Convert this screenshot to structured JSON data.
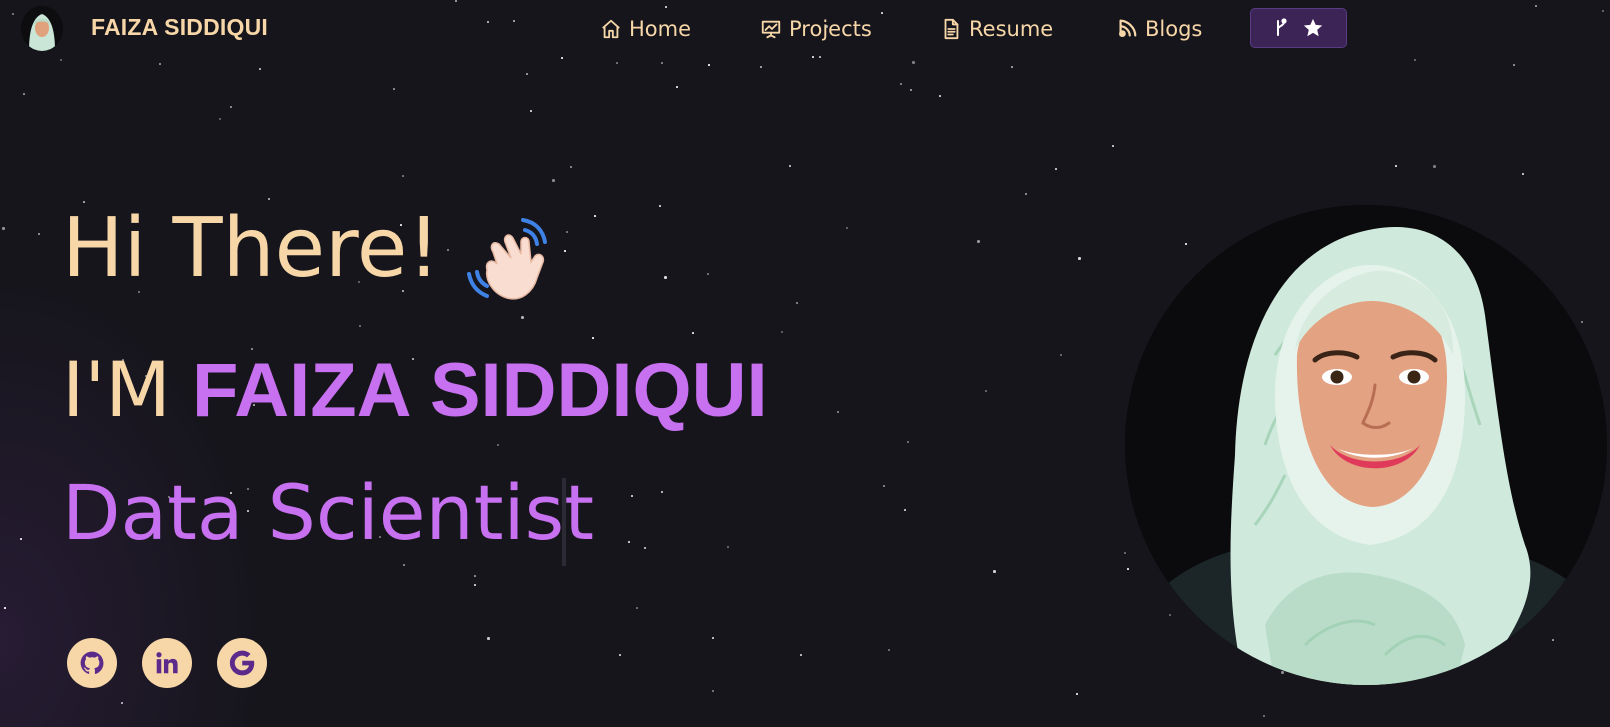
{
  "brand": {
    "name": "FAIZA SIDDIQUI",
    "avatar_icon": "avatar-photo"
  },
  "nav": {
    "items": [
      {
        "label": "Home",
        "icon": "home-icon"
      },
      {
        "label": "Projects",
        "icon": "presentation-chart-icon"
      },
      {
        "label": "Resume",
        "icon": "document-icon"
      },
      {
        "label": "Blogs",
        "icon": "rss-icon"
      }
    ],
    "repo_button": {
      "icons": [
        "git-fork-icon",
        "star-icon"
      ]
    }
  },
  "hero": {
    "greeting": "Hi There!",
    "intro_prefix": "I'M",
    "intro_name": "FAIZA SIDDIQUI",
    "role": "Data Scientist"
  },
  "social": [
    {
      "name": "github",
      "icon": "github-icon"
    },
    {
      "name": "linkedin",
      "icon": "linkedin-icon"
    },
    {
      "name": "google",
      "icon": "google-icon"
    }
  ],
  "colors": {
    "background": "#16151c",
    "cream": "#f7d7a8",
    "purple": "#c770f0",
    "button_bg": "#3c2456"
  }
}
